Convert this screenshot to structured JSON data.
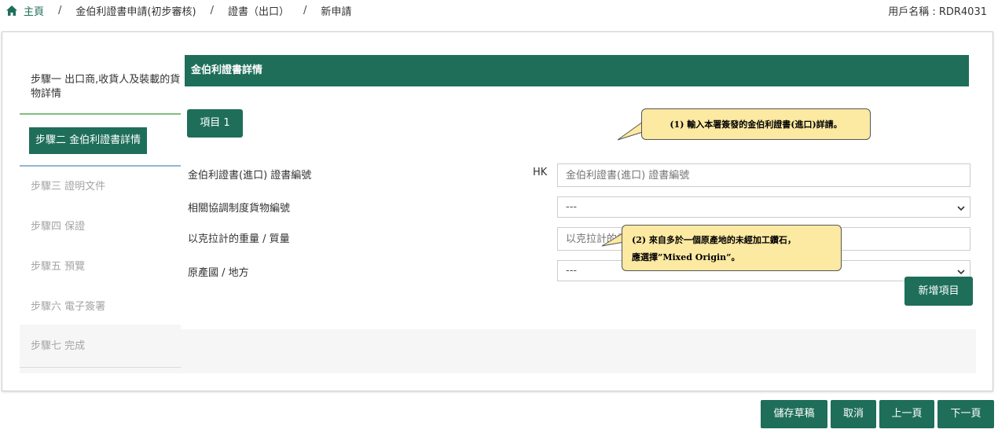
{
  "breadcrumb": {
    "home": "主頁",
    "items": [
      "金伯利證書申請(初步審核)",
      "證書（出口）",
      "新申請"
    ]
  },
  "user": {
    "label": "用戶名稱 : RDR4031"
  },
  "steps": [
    "步驟一 出口商,收貨人及裝載的貨物詳情",
    "步驟二 金伯利證書詳情",
    "步驟三 證明文件",
    "步驟四 保證",
    "步驟五 預覽",
    "步驟六 電子簽署",
    "步驟七 完成"
  ],
  "section": {
    "title": "金伯利證書詳情"
  },
  "item_tab": "項目 1",
  "form": {
    "cert_no_label": "金伯利證書(進口) 證書編號",
    "cert_no_prefix": "HK",
    "cert_no_placeholder": "金伯利證書(進口) 證書編號",
    "hs_label": "相關協調制度貨物編號",
    "hs_value": "---",
    "weight_label": "以克拉計的重量 / 質量",
    "weight_placeholder": "以克拉計的重量 / 質量",
    "origin_label": "原產國 / 地方",
    "origin_value": "---"
  },
  "add_item_label": "新增項目",
  "callouts": {
    "c1": "(1) 輸入本署簽發的金伯利證書(進口)詳請。",
    "c2_line1": "(2) 來自多於一個原產地的未經加工鑽石，",
    "c2_line2": "應選擇”Mixed Origin”。"
  },
  "footer": {
    "save_draft": "儲存草稿",
    "cancel": "取消",
    "prev": "上一頁",
    "next": "下一頁"
  },
  "colors": {
    "primary": "#1e6e5a",
    "callout_bg": "#fce9a2"
  }
}
